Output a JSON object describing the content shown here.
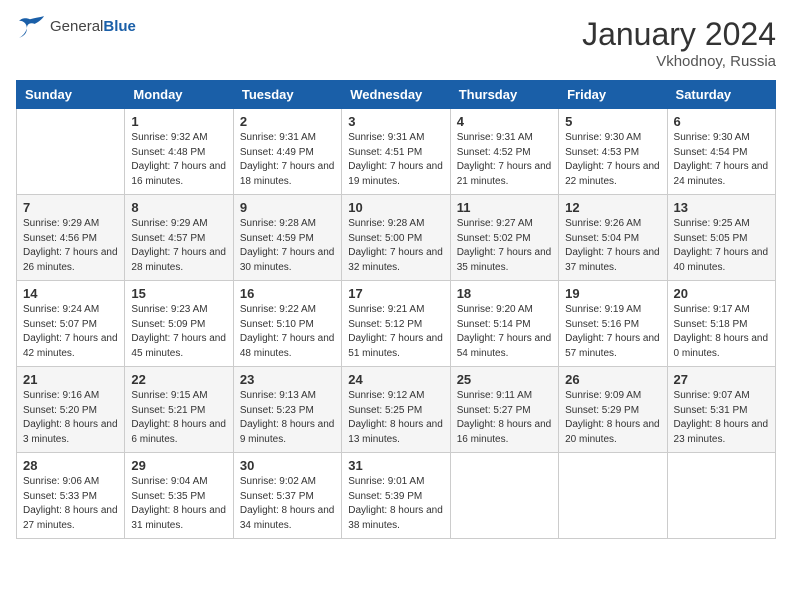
{
  "header": {
    "logo": {
      "general": "General",
      "blue": "Blue"
    },
    "title": "January 2024",
    "location": "Vkhodnoy, Russia"
  },
  "calendar": {
    "days_of_week": [
      "Sunday",
      "Monday",
      "Tuesday",
      "Wednesday",
      "Thursday",
      "Friday",
      "Saturday"
    ],
    "weeks": [
      [
        {
          "day": "",
          "sunrise": "",
          "sunset": "",
          "daylight": ""
        },
        {
          "day": "1",
          "sunrise": "9:32 AM",
          "sunset": "4:48 PM",
          "daylight": "7 hours and 16 minutes."
        },
        {
          "day": "2",
          "sunrise": "9:31 AM",
          "sunset": "4:49 PM",
          "daylight": "7 hours and 18 minutes."
        },
        {
          "day": "3",
          "sunrise": "9:31 AM",
          "sunset": "4:51 PM",
          "daylight": "7 hours and 19 minutes."
        },
        {
          "day": "4",
          "sunrise": "9:31 AM",
          "sunset": "4:52 PM",
          "daylight": "7 hours and 21 minutes."
        },
        {
          "day": "5",
          "sunrise": "9:30 AM",
          "sunset": "4:53 PM",
          "daylight": "7 hours and 22 minutes."
        },
        {
          "day": "6",
          "sunrise": "9:30 AM",
          "sunset": "4:54 PM",
          "daylight": "7 hours and 24 minutes."
        }
      ],
      [
        {
          "day": "7",
          "sunrise": "9:29 AM",
          "sunset": "4:56 PM",
          "daylight": "7 hours and 26 minutes."
        },
        {
          "day": "8",
          "sunrise": "9:29 AM",
          "sunset": "4:57 PM",
          "daylight": "7 hours and 28 minutes."
        },
        {
          "day": "9",
          "sunrise": "9:28 AM",
          "sunset": "4:59 PM",
          "daylight": "7 hours and 30 minutes."
        },
        {
          "day": "10",
          "sunrise": "9:28 AM",
          "sunset": "5:00 PM",
          "daylight": "7 hours and 32 minutes."
        },
        {
          "day": "11",
          "sunrise": "9:27 AM",
          "sunset": "5:02 PM",
          "daylight": "7 hours and 35 minutes."
        },
        {
          "day": "12",
          "sunrise": "9:26 AM",
          "sunset": "5:04 PM",
          "daylight": "7 hours and 37 minutes."
        },
        {
          "day": "13",
          "sunrise": "9:25 AM",
          "sunset": "5:05 PM",
          "daylight": "7 hours and 40 minutes."
        }
      ],
      [
        {
          "day": "14",
          "sunrise": "9:24 AM",
          "sunset": "5:07 PM",
          "daylight": "7 hours and 42 minutes."
        },
        {
          "day": "15",
          "sunrise": "9:23 AM",
          "sunset": "5:09 PM",
          "daylight": "7 hours and 45 minutes."
        },
        {
          "day": "16",
          "sunrise": "9:22 AM",
          "sunset": "5:10 PM",
          "daylight": "7 hours and 48 minutes."
        },
        {
          "day": "17",
          "sunrise": "9:21 AM",
          "sunset": "5:12 PM",
          "daylight": "7 hours and 51 minutes."
        },
        {
          "day": "18",
          "sunrise": "9:20 AM",
          "sunset": "5:14 PM",
          "daylight": "7 hours and 54 minutes."
        },
        {
          "day": "19",
          "sunrise": "9:19 AM",
          "sunset": "5:16 PM",
          "daylight": "7 hours and 57 minutes."
        },
        {
          "day": "20",
          "sunrise": "9:17 AM",
          "sunset": "5:18 PM",
          "daylight": "8 hours and 0 minutes."
        }
      ],
      [
        {
          "day": "21",
          "sunrise": "9:16 AM",
          "sunset": "5:20 PM",
          "daylight": "8 hours and 3 minutes."
        },
        {
          "day": "22",
          "sunrise": "9:15 AM",
          "sunset": "5:21 PM",
          "daylight": "8 hours and 6 minutes."
        },
        {
          "day": "23",
          "sunrise": "9:13 AM",
          "sunset": "5:23 PM",
          "daylight": "8 hours and 9 minutes."
        },
        {
          "day": "24",
          "sunrise": "9:12 AM",
          "sunset": "5:25 PM",
          "daylight": "8 hours and 13 minutes."
        },
        {
          "day": "25",
          "sunrise": "9:11 AM",
          "sunset": "5:27 PM",
          "daylight": "8 hours and 16 minutes."
        },
        {
          "day": "26",
          "sunrise": "9:09 AM",
          "sunset": "5:29 PM",
          "daylight": "8 hours and 20 minutes."
        },
        {
          "day": "27",
          "sunrise": "9:07 AM",
          "sunset": "5:31 PM",
          "daylight": "8 hours and 23 minutes."
        }
      ],
      [
        {
          "day": "28",
          "sunrise": "9:06 AM",
          "sunset": "5:33 PM",
          "daylight": "8 hours and 27 minutes."
        },
        {
          "day": "29",
          "sunrise": "9:04 AM",
          "sunset": "5:35 PM",
          "daylight": "8 hours and 31 minutes."
        },
        {
          "day": "30",
          "sunrise": "9:02 AM",
          "sunset": "5:37 PM",
          "daylight": "8 hours and 34 minutes."
        },
        {
          "day": "31",
          "sunrise": "9:01 AM",
          "sunset": "5:39 PM",
          "daylight": "8 hours and 38 minutes."
        },
        {
          "day": "",
          "sunrise": "",
          "sunset": "",
          "daylight": ""
        },
        {
          "day": "",
          "sunrise": "",
          "sunset": "",
          "daylight": ""
        },
        {
          "day": "",
          "sunrise": "",
          "sunset": "",
          "daylight": ""
        }
      ]
    ]
  }
}
